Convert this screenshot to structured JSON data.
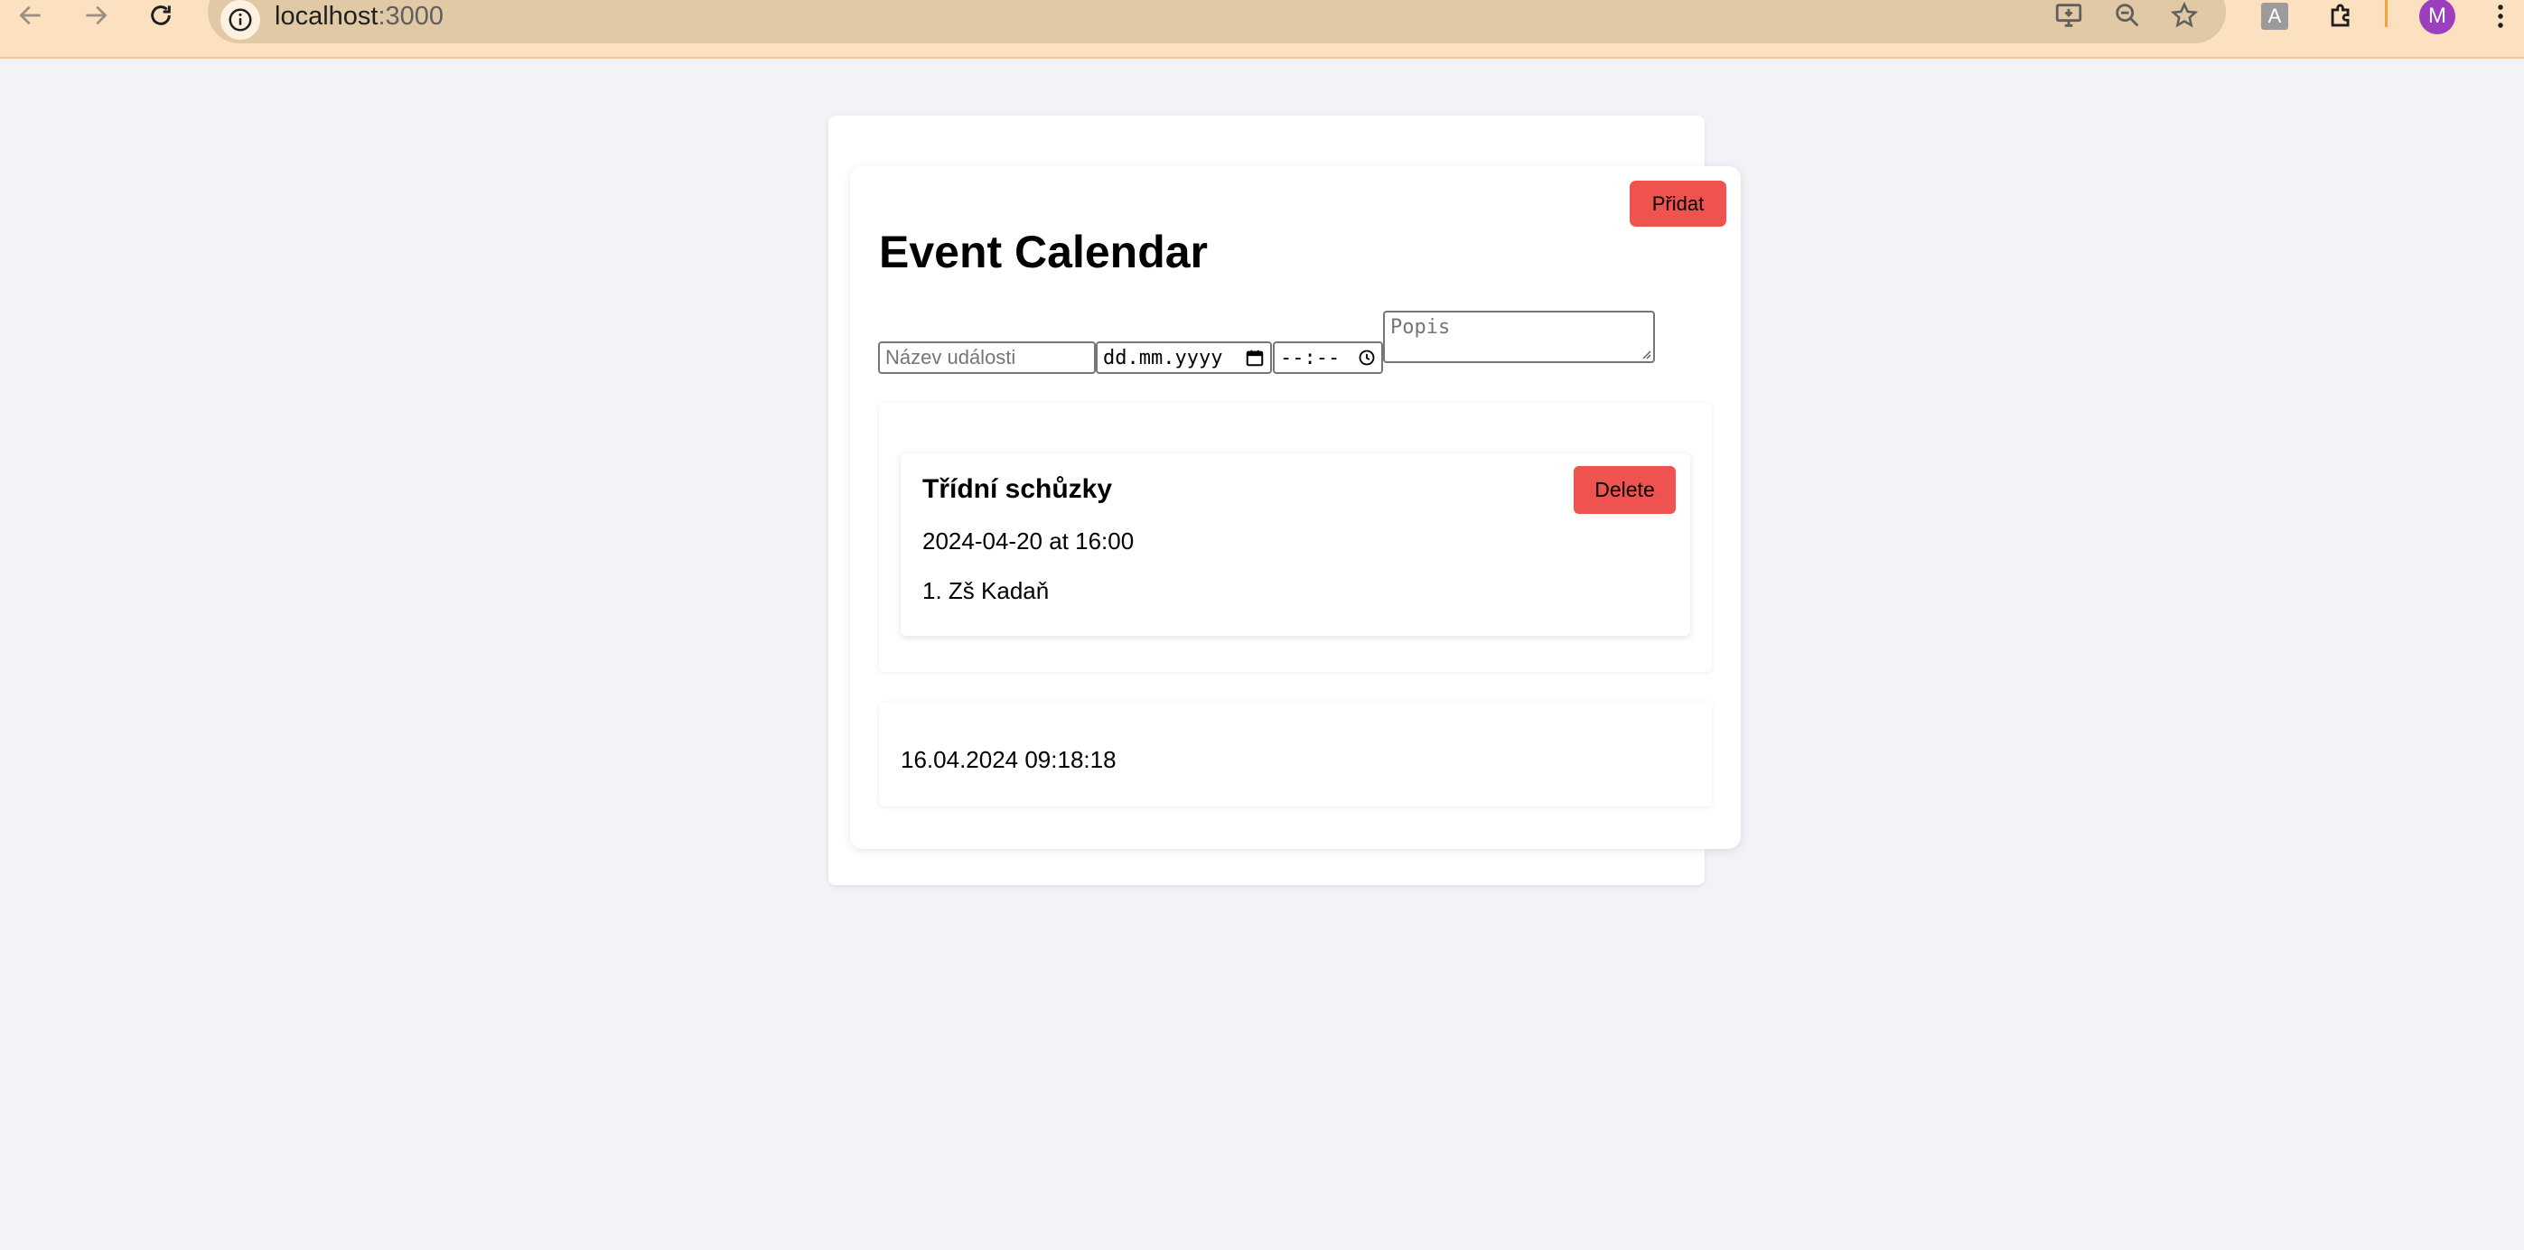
{
  "browser": {
    "url_host": "localhost",
    "url_port": ":3000",
    "profile_initial": "M",
    "translate_glyph": "A"
  },
  "page": {
    "add_button_label": "Přidat",
    "title": "Event Calendar",
    "form": {
      "name_placeholder": "Název události",
      "date_placeholder": "dd.mm.yyyy",
      "time_placeholder": "--:--",
      "description_placeholder": "Popis"
    },
    "events": [
      {
        "title": "Třídní schůzky",
        "when": "2024-04-20 at 16:00",
        "description": "1. Zš Kadaň",
        "delete_label": "Delete"
      }
    ],
    "current_datetime": "16.04.2024 09:18:18"
  },
  "colors": {
    "accent_button": "#ef5350",
    "page_background": "#f3f2f7",
    "browser_toolbar": "#fbe1bf",
    "avatar": "#9c3fbf"
  }
}
